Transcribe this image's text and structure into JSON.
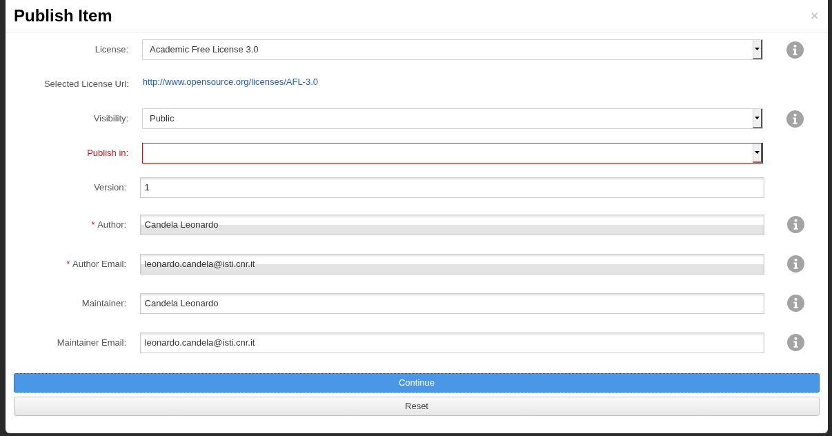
{
  "dialog": {
    "title": "Publish Item",
    "close": "×"
  },
  "fields": [
    {
      "kind": "select",
      "label": "License:",
      "value": "Academic Free License 3.0",
      "required": false,
      "invalid": false,
      "info": true
    },
    {
      "kind": "link",
      "label": "Selected License Url:",
      "value": "http://www.opensource.org/licenses/AFL-3.0",
      "required": false,
      "invalid": false,
      "info": false
    },
    {
      "kind": "select",
      "label": "Visibility:",
      "value": "Public",
      "required": false,
      "invalid": false,
      "info": true
    },
    {
      "kind": "select",
      "label": "Publish in:",
      "required": false,
      "invalid": true,
      "info": false
    },
    {
      "kind": "text",
      "label": "Version:",
      "value": "1",
      "required": false,
      "invalid": false,
      "readonly": false,
      "info": false
    },
    {
      "kind": "text",
      "label": "Author:",
      "value": "Candela Leonardo",
      "required": true,
      "invalid": false,
      "readonly": true,
      "info": true
    },
    {
      "kind": "text",
      "label": "Author Email:",
      "value": "leonardo.candela@isti.cnr.it",
      "required": true,
      "invalid": false,
      "readonly": true,
      "info": true
    },
    {
      "kind": "text",
      "label": "Maintainer:",
      "value": "Candela Leonardo",
      "required": false,
      "invalid": false,
      "readonly": false,
      "info": true
    },
    {
      "kind": "text",
      "label": "Maintainer Email:",
      "value": "leonardo.candela@isti.cnr.it",
      "required": false,
      "invalid": false,
      "readonly": false,
      "info": true
    }
  ],
  "required_mark": "*",
  "buttons": [
    {
      "label": "Continue",
      "kind": "primary"
    },
    {
      "label": "Reset",
      "kind": "default"
    }
  ]
}
